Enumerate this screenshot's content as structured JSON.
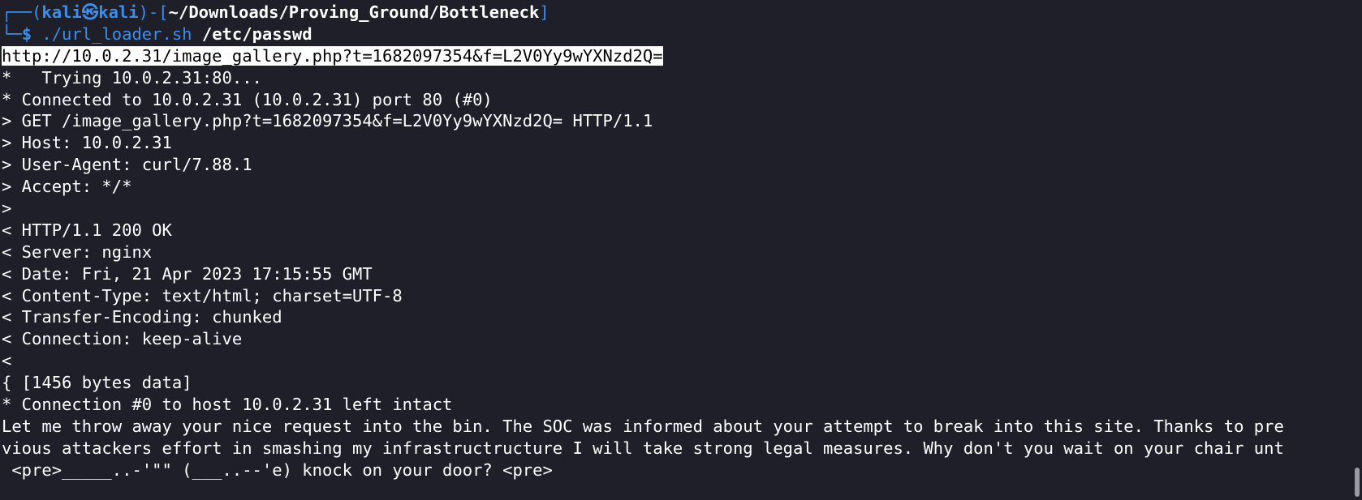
{
  "prompt": {
    "corner_top": "┌──(",
    "user": "kali",
    "at_symbol": "㉿",
    "host": "kali",
    "bracket_mid": ")-[",
    "path": "~/Downloads/Proving_Ground/Bottleneck",
    "bracket_close": "]",
    "corner_bottom": "└─",
    "dollar": "$ ",
    "command": "./url_loader.sh",
    "argument": " /etc/passwd"
  },
  "output": {
    "url_line": "http://10.0.2.31/image_gallery.php?t=1682097354&f=L2V0Yy9wYXNzd2Q=",
    "lines": [
      "*   Trying 10.0.2.31:80...",
      "* Connected to 10.0.2.31 (10.0.2.31) port 80 (#0)",
      "> GET /image_gallery.php?t=1682097354&f=L2V0Yy9wYXNzd2Q= HTTP/1.1",
      "> Host: 10.0.2.31",
      "> User-Agent: curl/7.88.1",
      "> Accept: */*",
      ">",
      "< HTTP/1.1 200 OK",
      "< Server: nginx",
      "< Date: Fri, 21 Apr 2023 17:15:55 GMT",
      "< Content-Type: text/html; charset=UTF-8",
      "< Transfer-Encoding: chunked",
      "< Connection: keep-alive",
      "<",
      "{ [1456 bytes data]",
      "* Connection #0 to host 10.0.2.31 left intact",
      "Let me throw away your nice request into the bin. The SOC was informed about your attempt to break into this site. Thanks to pre",
      "vious attackers effort in smashing my infrastructructure I will take strong legal measures. Why don't you wait on your chair unt",
      " <pre>_____..-'\"\" (___..--'e) knock on your door? <pre>"
    ]
  },
  "colors": {
    "background": "#1e1f29",
    "prompt_blue": "#3b8eea",
    "text": "#ffffff"
  }
}
